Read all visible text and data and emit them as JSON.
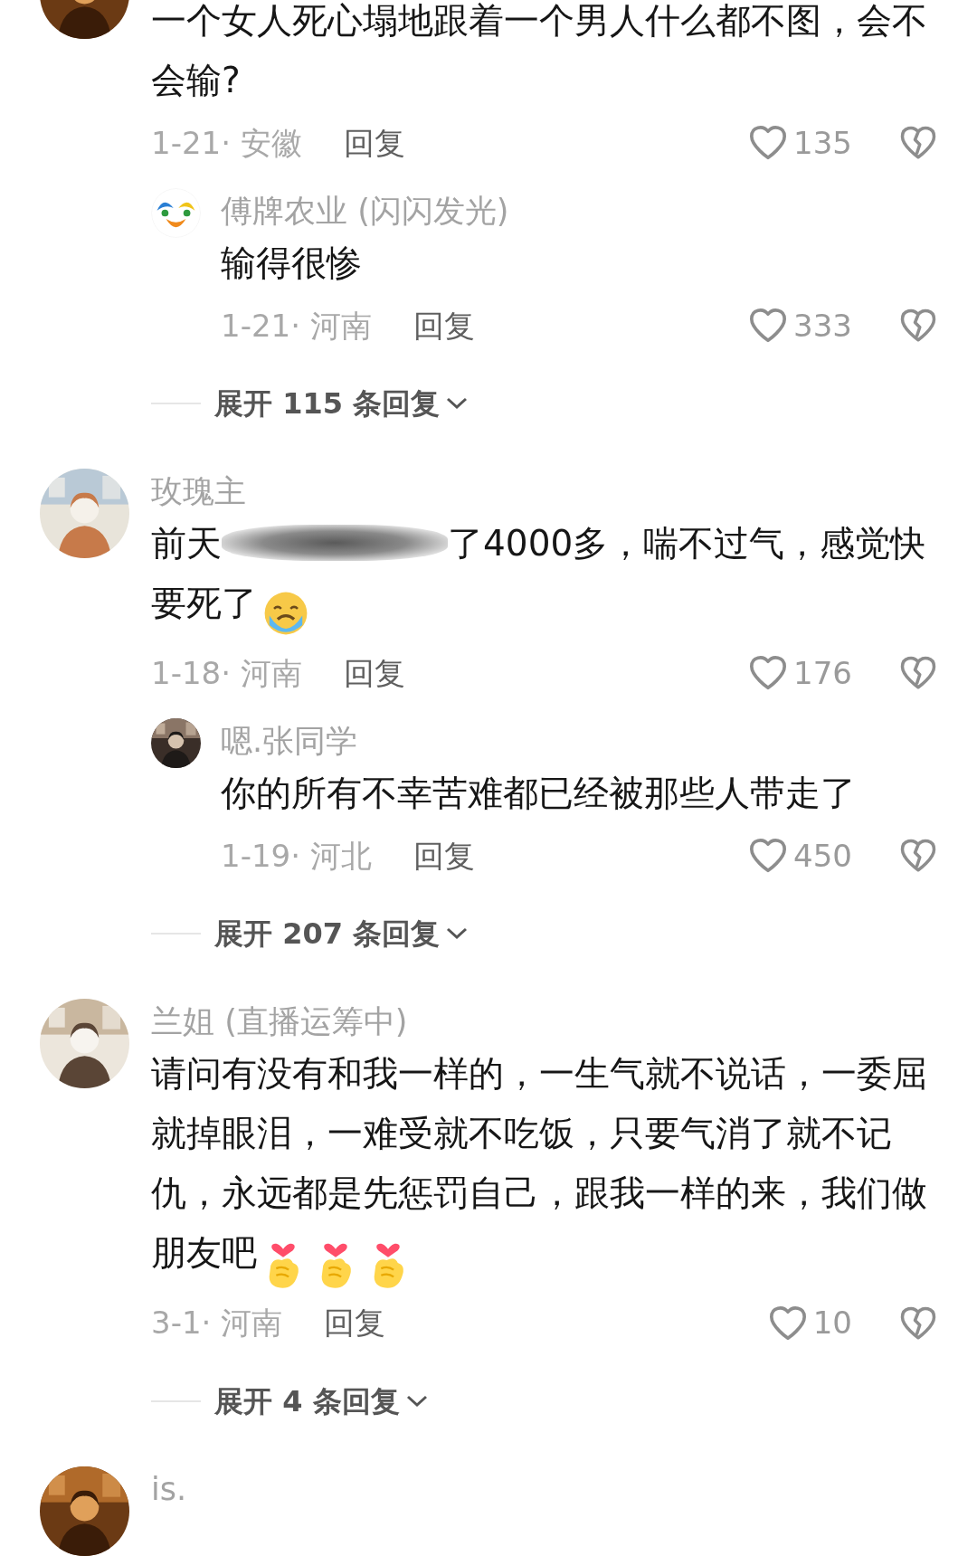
{
  "comments": [
    {
      "body": [
        {
          "kind": "text",
          "text": "一个女人死心塌地跟着一个男人什么都不图，会不会输?"
        }
      ],
      "date_location": "1-21· 安徽",
      "reply_label": "回复",
      "likes": "135",
      "replies": [
        {
          "author": "傅牌农业 (闪闪发光)",
          "avatar": {
            "kind": "logo"
          },
          "body": [
            {
              "kind": "text",
              "text": "输得很惨"
            }
          ],
          "date_location": "1-21· 河南",
          "reply_label": "回复",
          "likes": "333"
        }
      ],
      "expand_label": "展开 115 条回复"
    },
    {
      "author": "玫瑰主",
      "body": [
        {
          "kind": "text",
          "text": "前天"
        },
        {
          "kind": "redaction"
        },
        {
          "kind": "text",
          "text": "了4000多，喘不过气，感觉快要死了"
        },
        {
          "kind": "crying-emoji"
        }
      ],
      "date_location": "1-18· 河南",
      "reply_label": "回复",
      "likes": "176",
      "replies": [
        {
          "author": "嗯.张同学",
          "body": [
            {
              "kind": "text",
              "text": "你的所有不幸苦难都已经被那些人带走了"
            }
          ],
          "date_location": "1-19· 河北",
          "reply_label": "回复",
          "likes": "450"
        }
      ],
      "expand_label": "展开 207 条回复"
    },
    {
      "author": "兰姐 (直播运筹中)",
      "body": [
        {
          "kind": "text",
          "text": "请问有没有和我一样的，一生气就不说话，一委屈就掉眼泪，一难受就不吃饭，只要气消了就不记仇，永远都是先惩罚自己，跟我一样的来，我们做朋友吧"
        },
        {
          "kind": "finger-heart-emoji"
        },
        {
          "kind": "finger-heart-emoji"
        },
        {
          "kind": "finger-heart-emoji"
        }
      ],
      "date_location": "3-1· 河南",
      "reply_label": "回复",
      "likes": "10",
      "expand_label": "展开 4 条回复"
    },
    {
      "author": "is."
    }
  ]
}
